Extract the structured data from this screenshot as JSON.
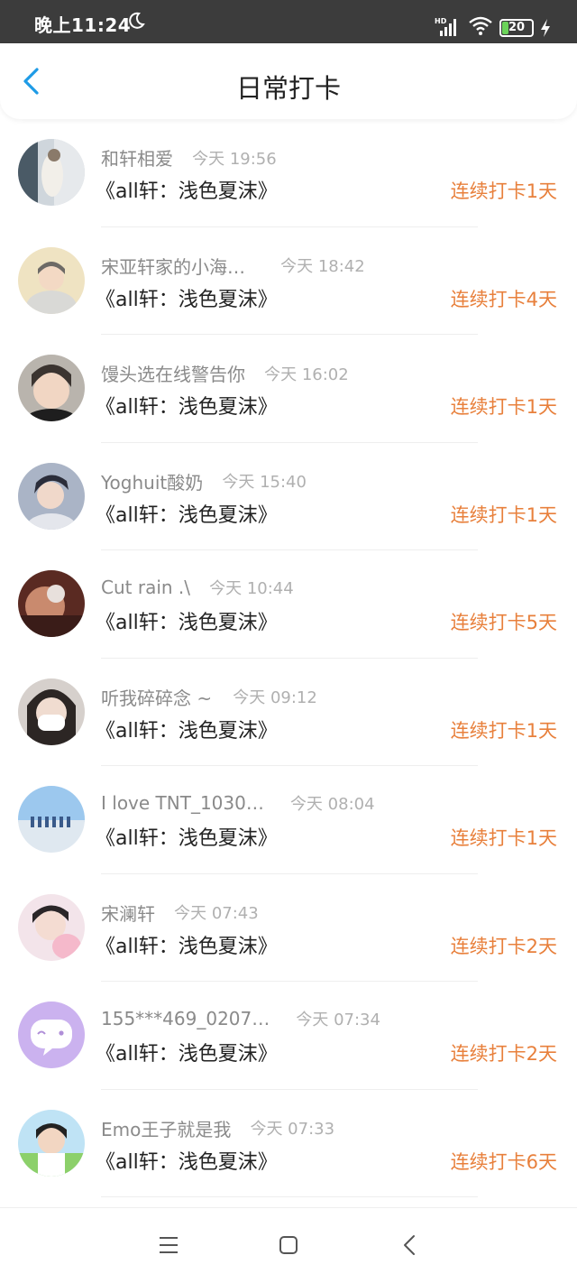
{
  "status_bar": {
    "time": "晚上11:24",
    "battery_level": "20",
    "network_label": "HD"
  },
  "header": {
    "title": "日常打卡",
    "back_icon": "chevron-left-icon",
    "accent_color": "#1e9be6"
  },
  "colors": {
    "streak": "#e8803c",
    "username": "#8a8a8a",
    "time": "#b0b0b0"
  },
  "items": [
    {
      "username": "和轩相爱",
      "time": "今天 19:56",
      "book": "《all轩：浅色夏沫》",
      "streak": "连续打卡1天"
    },
    {
      "username": "宋亚轩家的小海…",
      "time": "今天 18:42",
      "book": "《all轩：浅色夏沫》",
      "streak": "连续打卡4天"
    },
    {
      "username": "馒头选在线警告你",
      "time": "今天 16:02",
      "book": "《all轩：浅色夏沫》",
      "streak": "连续打卡1天"
    },
    {
      "username": "Yoghuit酸奶",
      "time": "今天 15:40",
      "book": "《all轩：浅色夏沫》",
      "streak": "连续打卡1天"
    },
    {
      "username": "Cut rain .\\",
      "time": "今天 10:44",
      "book": "《all轩：浅色夏沫》",
      "streak": "连续打卡5天"
    },
    {
      "username": "听我碎碎念 ~",
      "time": "今天 09:12",
      "book": "《all轩：浅色夏沫》",
      "streak": "连续打卡1天"
    },
    {
      "username": "I love TNT_1030…",
      "time": "今天 08:04",
      "book": "《all轩：浅色夏沫》",
      "streak": "连续打卡1天"
    },
    {
      "username": "宋澜轩",
      "time": "今天 07:43",
      "book": "《all轩：浅色夏沫》",
      "streak": "连续打卡2天"
    },
    {
      "username": "155***469_0207…",
      "time": "今天 07:34",
      "book": "《all轩：浅色夏沫》",
      "streak": "连续打卡2天"
    },
    {
      "username": "Emo王子就是我",
      "time": "今天 07:33",
      "book": "《all轩：浅色夏沫》",
      "streak": "连续打卡6天"
    }
  ],
  "nav": {
    "menu_icon": "menu-icon",
    "home_icon": "home-square-icon",
    "back_icon": "back-triangle-icon"
  }
}
